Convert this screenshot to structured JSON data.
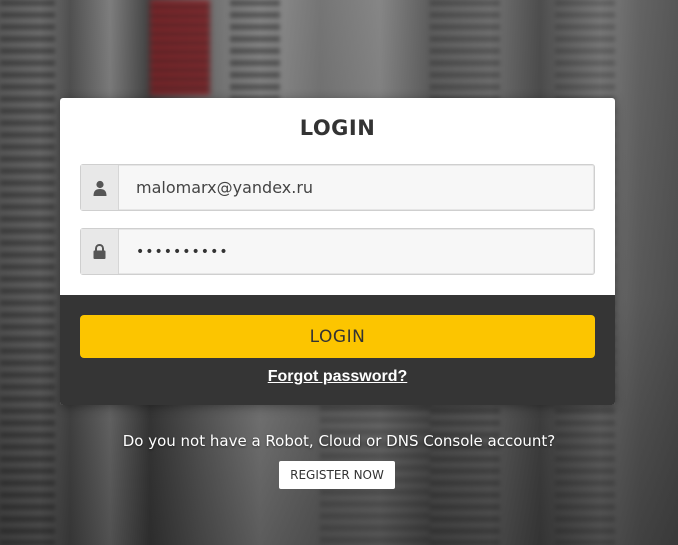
{
  "login_card": {
    "title": "LOGIN",
    "username": {
      "icon": "user-icon",
      "value": "malomarx@yandex.ru"
    },
    "password": {
      "icon": "lock-icon",
      "value": "••••••••••"
    },
    "login_button_label": "LOGIN",
    "forgot_password_label": "Forgot password?"
  },
  "register": {
    "prompt": "Do you not have a Robot, Cloud or DNS Console account?",
    "button_label": "REGISTER NOW"
  },
  "colors": {
    "accent": "#fcc500",
    "footer_bg": "#353535",
    "card_bg": "#ffffff"
  }
}
